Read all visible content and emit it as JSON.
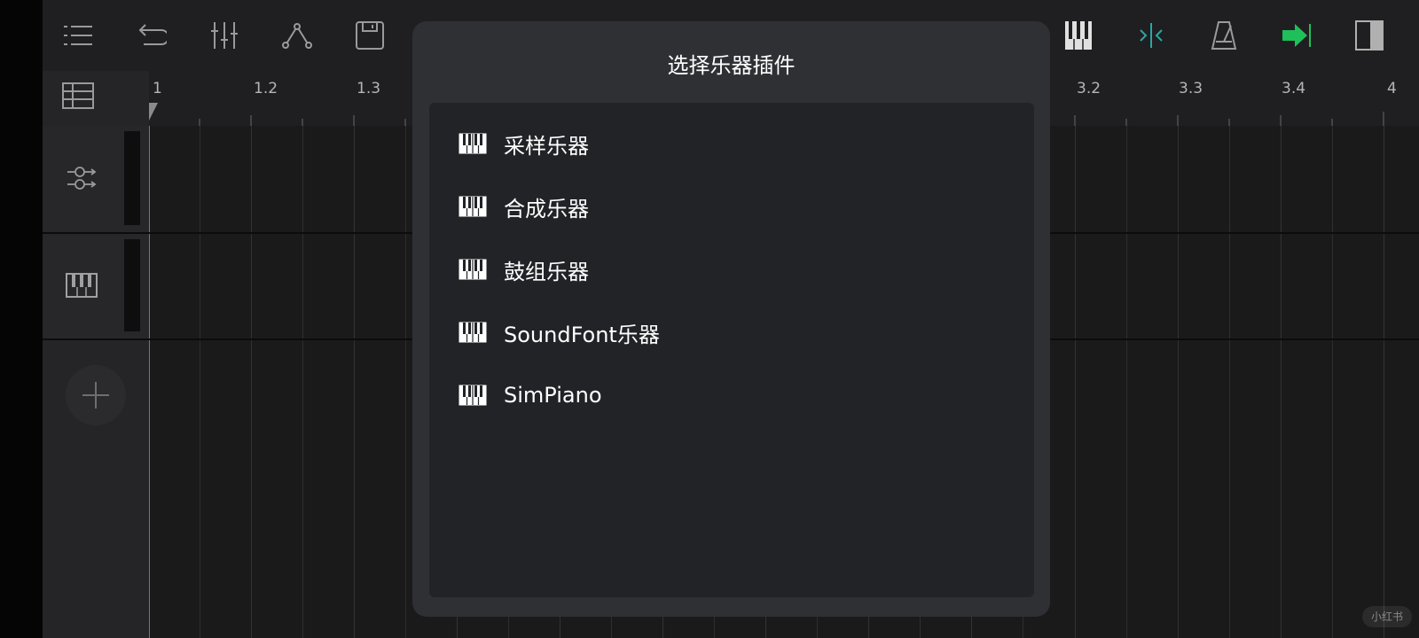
{
  "dialog": {
    "title": "选择乐器插件",
    "items": [
      {
        "label": "采样乐器",
        "icon": "piano-icon"
      },
      {
        "label": "合成乐器",
        "icon": "piano-icon"
      },
      {
        "label": "鼓组乐器",
        "icon": "piano-icon"
      },
      {
        "label": "SoundFont乐器",
        "icon": "piano-icon"
      },
      {
        "label": "SimPiano",
        "icon": "piano-icon"
      }
    ]
  },
  "ruler": {
    "labels": [
      "1",
      "1.2",
      "1.3",
      "3.2",
      "3.3",
      "3.4",
      "4"
    ]
  },
  "toolbar": {
    "icons": [
      "menu-icon",
      "undo-icon",
      "mixer-icon",
      "automation-icon",
      "save-icon",
      "piano-keys-icon",
      "snap-icon",
      "metronome-icon",
      "go-to-end-icon",
      "panel-toggle-icon"
    ]
  },
  "tracks": {
    "icons": [
      "aux-track-icon",
      "instrument-track-icon"
    ],
    "add_button_icon": "add-icon"
  },
  "watermark": "小红书",
  "colors": {
    "accent_green": "#1fbf5a",
    "snap_teal": "#2aa7a2",
    "dialog_bg": "#2e3034",
    "list_bg": "#222327"
  }
}
